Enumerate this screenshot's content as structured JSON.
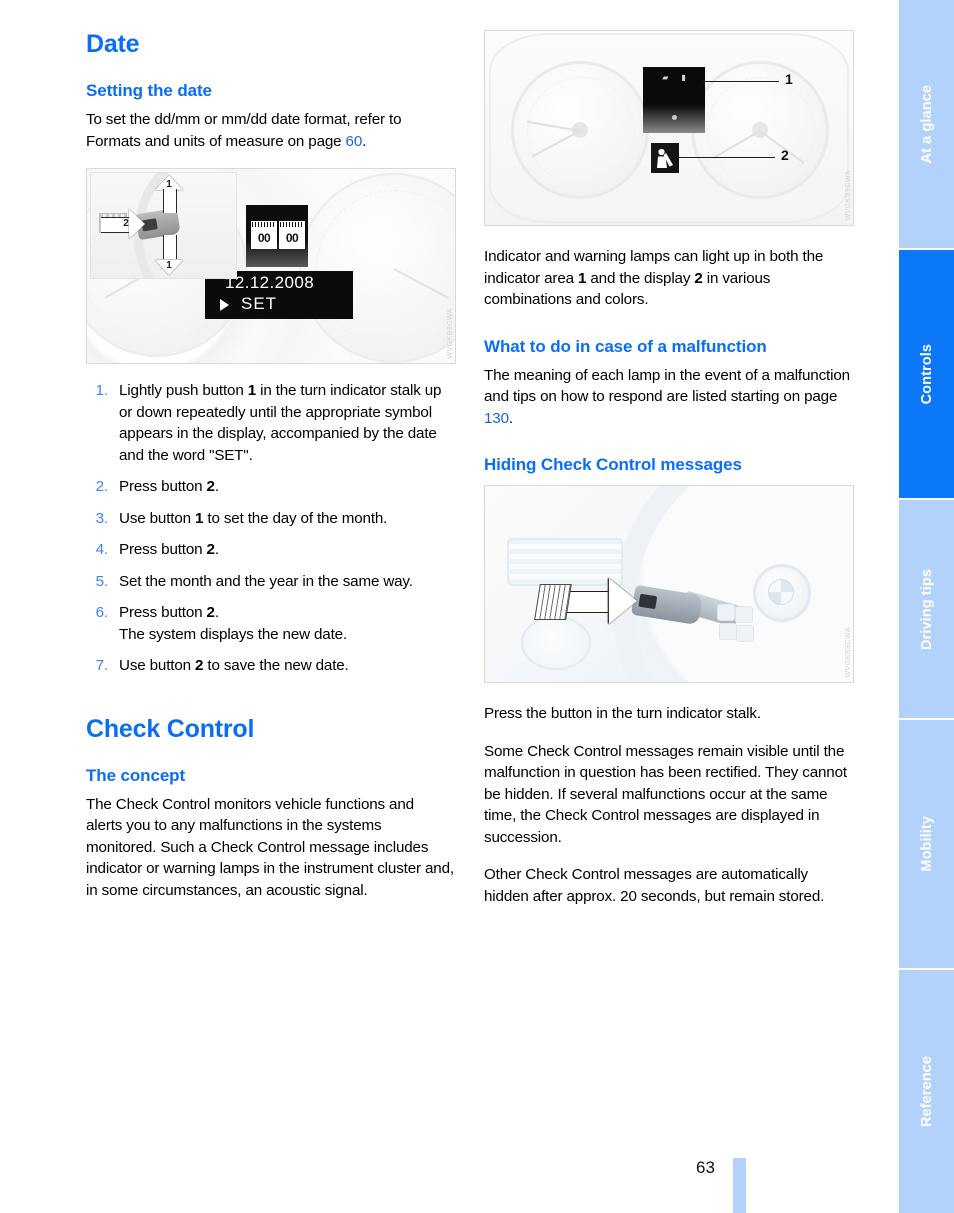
{
  "document": {
    "page_number": "63"
  },
  "left_column": {
    "section_title": "Date",
    "subsection_title": "Setting the date",
    "intro_before_ref": "To set the dd/mm or mm/dd date format, refer to Formats and units of measure on page ",
    "intro_page_ref": "60",
    "intro_after_ref": ".",
    "figure_date": {
      "caption_watermark": "WVGKB9CWA",
      "display_date": "12.12.2008",
      "display_set": "SET",
      "calendar_left_value": "00",
      "calendar_right_value": "00",
      "callout_up": "1",
      "callout_down": "1",
      "callout_right": "2"
    },
    "steps": [
      {
        "num": "1.",
        "text_parts": [
          "Lightly push button ",
          "1",
          " in the turn indicator stalk up or down repeatedly until the appropriate symbol appears in the display, accompanied by the date and the word \"SET\"."
        ]
      },
      {
        "num": "2.",
        "text_parts": [
          "Press button ",
          "2",
          "."
        ]
      },
      {
        "num": "3.",
        "text_parts": [
          "Use button ",
          "1",
          " to set the day of the month."
        ]
      },
      {
        "num": "4.",
        "text_parts": [
          "Press button ",
          "2",
          "."
        ]
      },
      {
        "num": "5.",
        "text_parts": [
          "Set the month and the year in the same way.",
          "",
          ""
        ]
      },
      {
        "num": "6.",
        "text_parts": [
          "Press button ",
          "2",
          ".\nThe system displays the new date."
        ]
      },
      {
        "num": "7.",
        "text_parts": [
          "Use button ",
          "2",
          " to save the new date."
        ]
      }
    ],
    "check_control_title": "Check Control",
    "concept_title": "The concept",
    "concept_text": "The Check Control monitors vehicle functions and alerts you to any malfunctions in the systems monitored. Such a Check Control message includes indicator or warning lamps in the instrument cluster and, in some circumstances, an acoustic signal."
  },
  "right_column": {
    "figure_cluster": {
      "caption_watermark": "WVGKB9CWA",
      "callout_1": "1",
      "callout_2": "2"
    },
    "indicator_text_a": "Indicator and warning lamps can light up in both the indicator area ",
    "indicator_bold_1": "1",
    "indicator_text_b": " and the display ",
    "indicator_bold_2": "2",
    "indicator_text_c": " in various combinations and colors.",
    "malfunction_title": "What to do in case of a malfunction",
    "malfunction_text_before": "The meaning of each lamp in the event of a malfunction and tips on how to respond are listed starting on page ",
    "malfunction_page_ref": "130",
    "malfunction_text_after": ".",
    "hiding_title": "Hiding Check Control messages",
    "figure_stalk": {
      "caption_watermark": "WVGKB9CWA"
    },
    "press_button_text": "Press the button in the turn indicator stalk.",
    "some_messages_text": "Some Check Control messages remain visible until the malfunction in question has been rectified. They cannot be hidden. If several malfunctions occur at the same time, the Check Control messages are displayed in succession.",
    "other_messages_text": "Other Check Control messages are automatically hidden after approx. 20 seconds, but remain stored."
  },
  "nav_tabs": [
    {
      "label": "At a glance",
      "active": false
    },
    {
      "label": "Controls",
      "active": true
    },
    {
      "label": "Driving tips",
      "active": false
    },
    {
      "label": "Mobility",
      "active": false
    },
    {
      "label": "Reference",
      "active": false
    }
  ],
  "colors": {
    "heading_blue": "#0a6ef5",
    "tab_inactive": "#b3d2fb",
    "tab_active": "#0a78f8",
    "list_number": "#3b82f6",
    "page_ref": "#1a63d8"
  }
}
